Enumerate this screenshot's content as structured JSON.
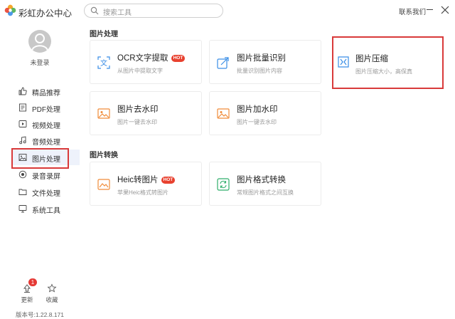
{
  "app": {
    "title": "彩虹办公中心",
    "contact": "联系我们"
  },
  "search": {
    "placeholder": "搜索工具"
  },
  "user": {
    "login_status": "未登录"
  },
  "sidebar": {
    "items": [
      {
        "label": "精品推荐",
        "icon": "thumbs-up-icon"
      },
      {
        "label": "PDF处理",
        "icon": "pdf-icon"
      },
      {
        "label": "视频处理",
        "icon": "video-icon"
      },
      {
        "label": "音频处理",
        "icon": "music-note-icon"
      },
      {
        "label": "图片处理",
        "icon": "image-icon",
        "active": true
      },
      {
        "label": "录音录屏",
        "icon": "record-icon"
      },
      {
        "label": "文件处理",
        "icon": "folder-icon"
      },
      {
        "label": "系统工具",
        "icon": "monitor-icon"
      }
    ]
  },
  "footer": {
    "update_label": "更新",
    "update_badge": "1",
    "favorite_label": "收藏",
    "version": "版本号:1.22.8.171"
  },
  "sections": [
    {
      "title": "图片处理",
      "cards": [
        {
          "title": "OCR文字提取",
          "desc": "从图片中提取文字",
          "hot": true,
          "icon": "ocr-icon"
        },
        {
          "title": "图片批量识别",
          "desc": "批量识别图片内容",
          "hot": false,
          "icon": "batch-recognize-icon"
        },
        {
          "title": "图片压缩",
          "desc": "图片压缩大小，高保真",
          "hot": false,
          "icon": "compress-icon"
        },
        {
          "title": "图片去水印",
          "desc": "图片一键去水印",
          "hot": false,
          "icon": "remove-watermark-icon"
        },
        {
          "title": "图片加水印",
          "desc": "图片一键去水印",
          "hot": false,
          "icon": "add-watermark-icon"
        }
      ]
    },
    {
      "title": "图片转换",
      "cards": [
        {
          "title": "Heic转图片",
          "desc": "苹果Heic格式转图片",
          "hot": true,
          "icon": "heic-convert-icon"
        },
        {
          "title": "图片格式转换",
          "desc": "常规图片格式之间互换",
          "hot": false,
          "icon": "format-convert-icon"
        }
      ]
    }
  ],
  "hot_label": "HOT",
  "colors": {
    "accent": "#3a8ee6",
    "highlight": "#d93a3a",
    "hot": "#e8412f",
    "orange": "#f08c3a",
    "green": "#2fae6a"
  }
}
